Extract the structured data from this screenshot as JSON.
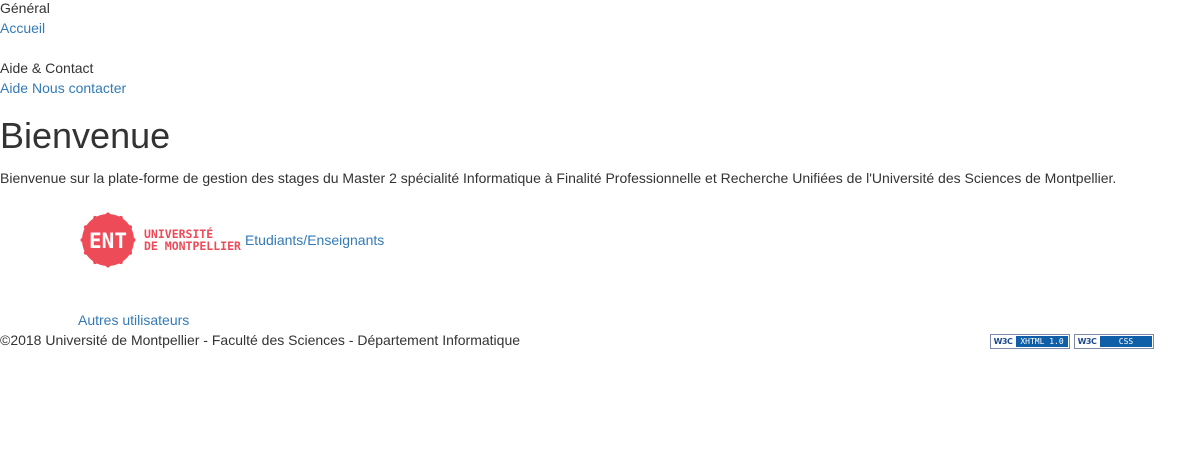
{
  "nav": {
    "general_title": "Général",
    "home_link": "Accueil",
    "help_title": "Aide & Contact",
    "help_link": "Aide",
    "contact_link": "Nous contacter"
  },
  "main": {
    "title": "Bienvenue",
    "intro": "Bienvenue sur la plate-forme de gestion des stages du Master 2 spécialité Informatique à Finalité Professionnelle et Recherche Unifiées de l'Université des Sciences de Montpellier.",
    "ent_logo": {
      "badge_text": "ENT",
      "line1": "UNIVERSITÉ",
      "line2": "DE MONTPELLIER",
      "color": "#ee4b58"
    },
    "ent_login_link": "Etudiants/Enseignants",
    "other_users_link": "Autres utilisateurs"
  },
  "footer": {
    "copyright": "©2018 Université de Montpellier - Faculté des Sciences - Département Informatique",
    "badges": [
      {
        "left": "W3C",
        "right": "XHTML 1.0"
      },
      {
        "left": "W3C",
        "right": "CSS"
      }
    ]
  },
  "colors": {
    "link": "#337ab7",
    "text": "#333333",
    "brand": "#ee4b58",
    "w3c_blue": "#0f5fa8"
  }
}
